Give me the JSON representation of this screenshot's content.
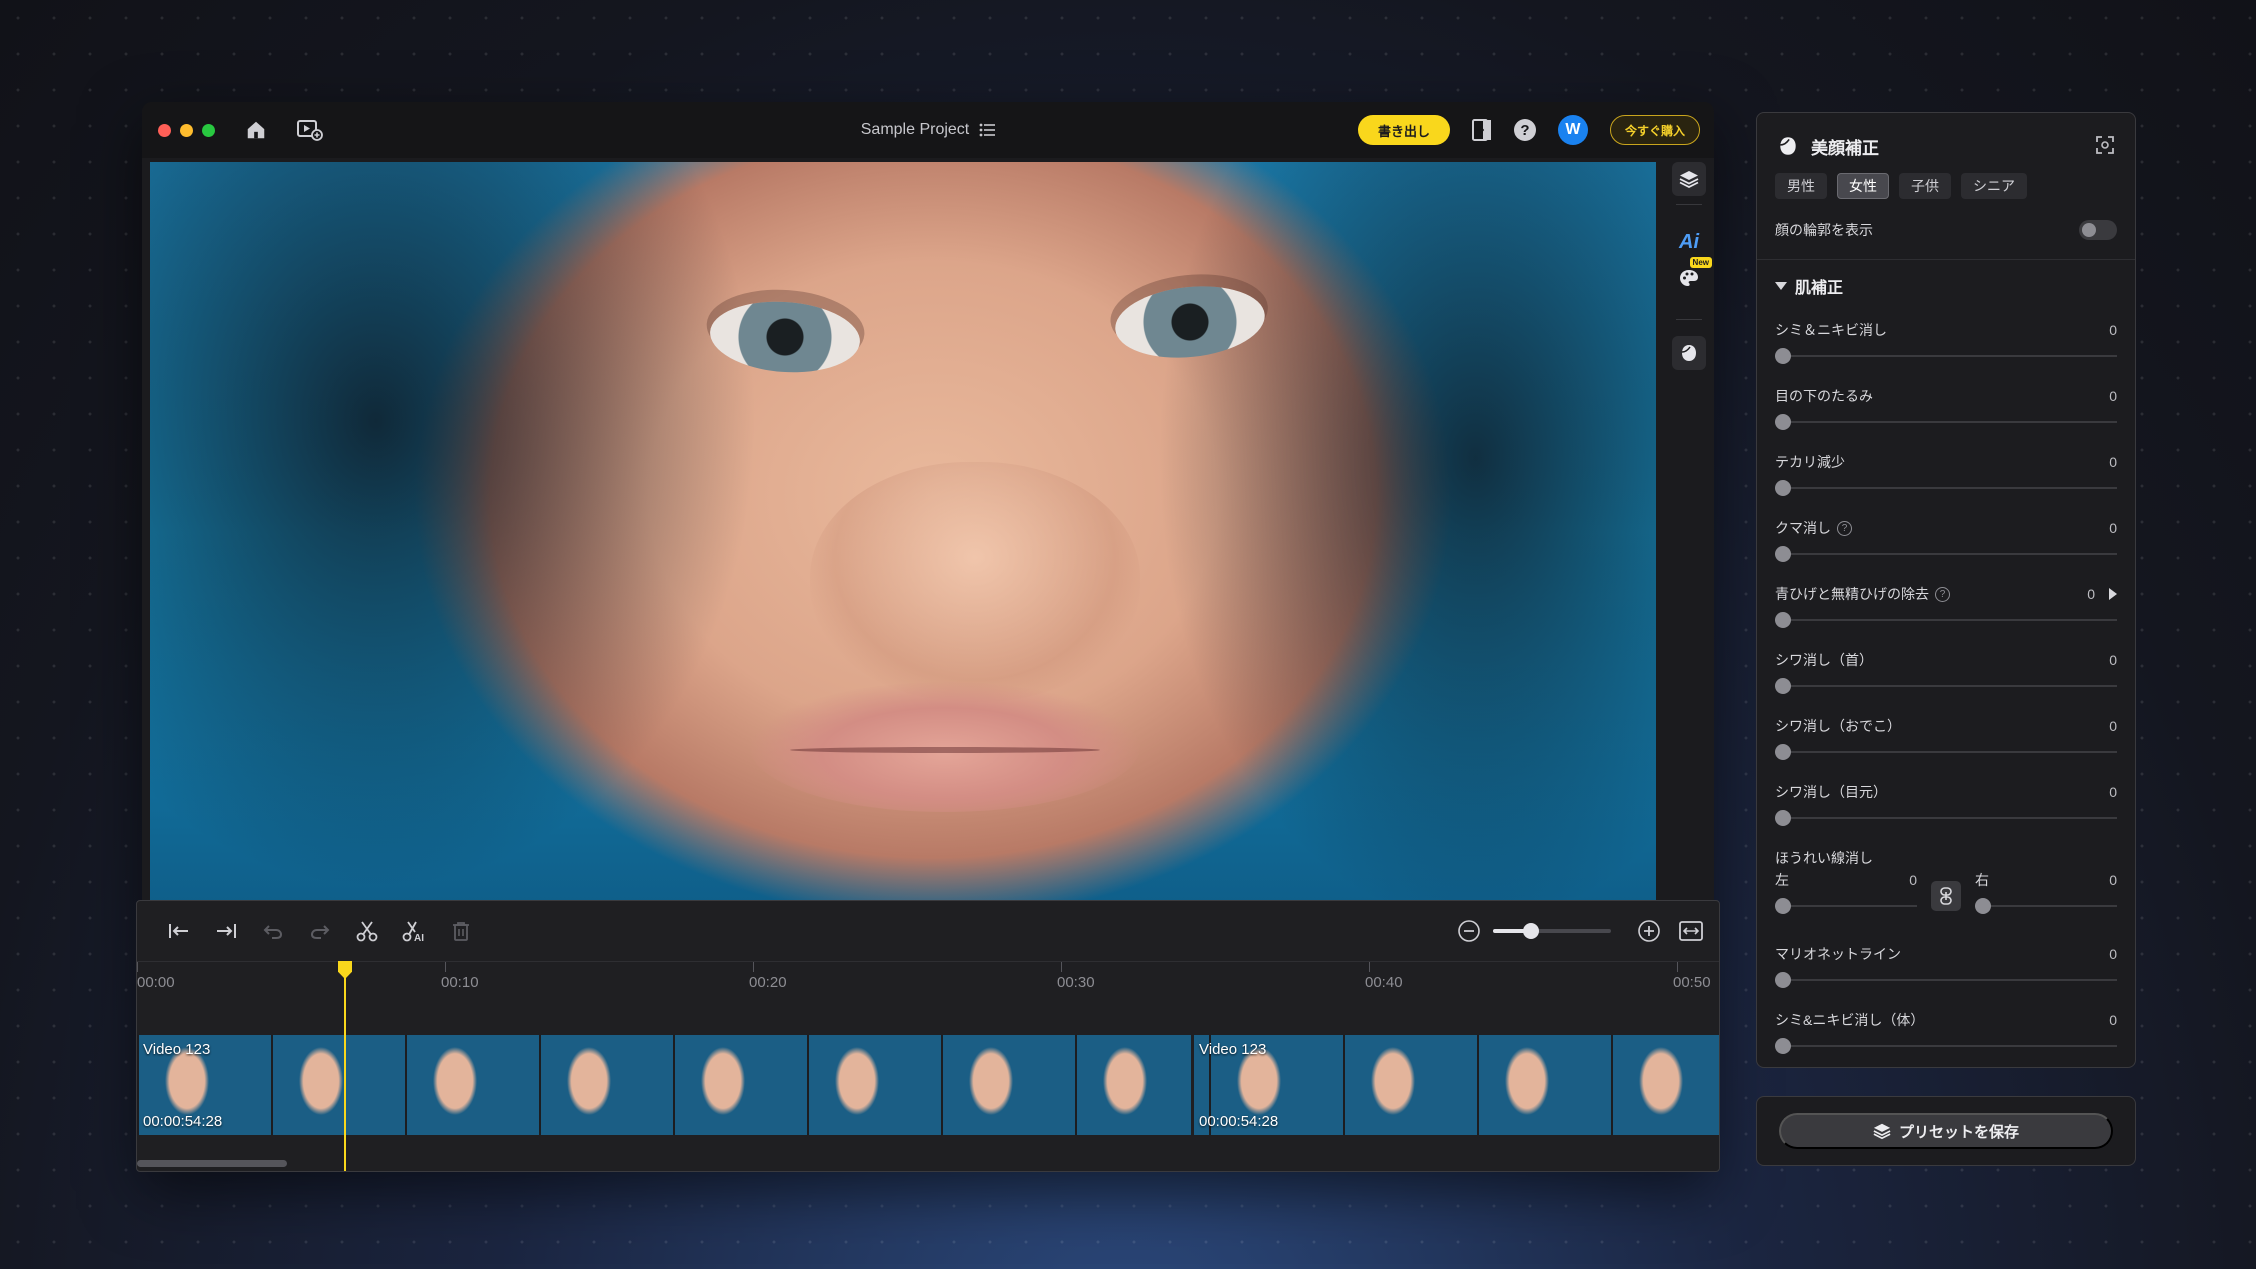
{
  "titlebar": {
    "project_title": "Sample Project",
    "export_label": "書き出し",
    "help_label": "?",
    "avatar_initial": "W",
    "buy_label": "今すぐ購入"
  },
  "side_tools": {
    "ai_label": "Ai",
    "new_badge": "New"
  },
  "timeline": {
    "ticks": [
      "00:00",
      "00:10",
      "00:20",
      "00:30",
      "00:40",
      "00:50"
    ],
    "clips": [
      {
        "name": "Video 123",
        "duration": "00:00:54:28"
      },
      {
        "name": "Video 123",
        "duration": "00:00:54:28"
      }
    ]
  },
  "panel": {
    "title": "美顔補正",
    "tabs": [
      "男性",
      "女性",
      "子供",
      "シニア"
    ],
    "active_tab": "女性",
    "contour_label": "顔の輪郭を表示",
    "section_label": "肌補正",
    "sliders": [
      {
        "label": "シミ＆ニキビ消し",
        "value": "0"
      },
      {
        "label": "目の下のたるみ",
        "value": "0"
      },
      {
        "label": "テカリ減少",
        "value": "0"
      },
      {
        "label": "クマ消し",
        "value": "0"
      },
      {
        "label": "青ひげと無精ひげの除去",
        "value": "0"
      },
      {
        "label": "シワ消し（首）",
        "value": "0"
      },
      {
        "label": "シワ消し（おでこ）",
        "value": "0"
      },
      {
        "label": "シワ消し（目元）",
        "value": "0"
      }
    ],
    "nasolabial": {
      "label": "ほうれい線消し",
      "left_label": "左",
      "left_value": "0",
      "right_label": "右",
      "right_value": "0"
    },
    "sliders_bottom": [
      {
        "label": "マリオネットライン",
        "value": "0"
      },
      {
        "label": "シミ&ニキビ消し（体）",
        "value": "0"
      }
    ],
    "preset_label": "プリセットを保存"
  },
  "colors": {
    "accent": "#f9d71c",
    "avatar": "#1a82f0",
    "ai": "#4e9df6"
  }
}
